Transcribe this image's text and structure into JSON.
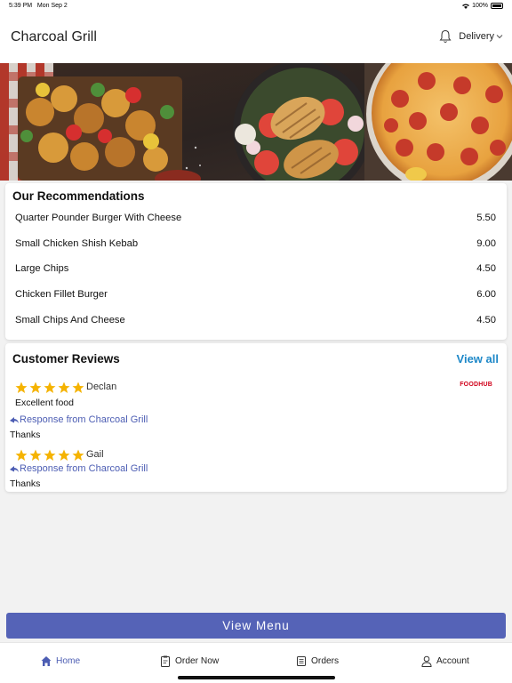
{
  "status_bar": {
    "time": "5:39 PM",
    "date": "Mon Sep 2",
    "battery": "100%",
    "battery_level": 1.0
  },
  "header": {
    "title": "Charcoal Grill",
    "mode_label": "Delivery",
    "icons": [
      "bell-icon",
      "chevron-down-icon"
    ]
  },
  "recommendations": {
    "title": "Our Recommendations",
    "items": [
      {
        "name": "Quarter Pounder Burger With Cheese",
        "price": "5.50"
      },
      {
        "name": "Small Chicken Shish Kebab",
        "price": "9.00"
      },
      {
        "name": "Large Chips",
        "price": "4.50"
      },
      {
        "name": "Chicken Fillet Burger",
        "price": "6.00"
      },
      {
        "name": "Small Chips And Cheese",
        "price": "4.50"
      }
    ]
  },
  "reviews": {
    "title": "Customer Reviews",
    "view_all": "View all",
    "source": "FOODHUB",
    "items": [
      {
        "reviewer": "Declan",
        "rating": 5,
        "text": "Excellent food",
        "response_label": "Response from Charcoal Grill",
        "response_text": "Thanks"
      },
      {
        "reviewer": "Gail",
        "rating": 5,
        "text": "",
        "response_label": "Response from Charcoal Grill",
        "response_text": "Thanks"
      }
    ]
  },
  "view_menu_label": "View Menu",
  "tabs": [
    {
      "label": "Home",
      "icon": "home-icon",
      "active": true
    },
    {
      "label": "Order Now",
      "icon": "clipboard-icon",
      "active": false
    },
    {
      "label": "Orders",
      "icon": "receipt-icon",
      "active": false
    },
    {
      "label": "Account",
      "icon": "person-icon",
      "active": false
    }
  ],
  "colors": {
    "accent": "#5563b7",
    "link": "#1e88c8",
    "response": "#4c5db3",
    "star": "#f5b301",
    "brand_red": "#d0021b"
  }
}
